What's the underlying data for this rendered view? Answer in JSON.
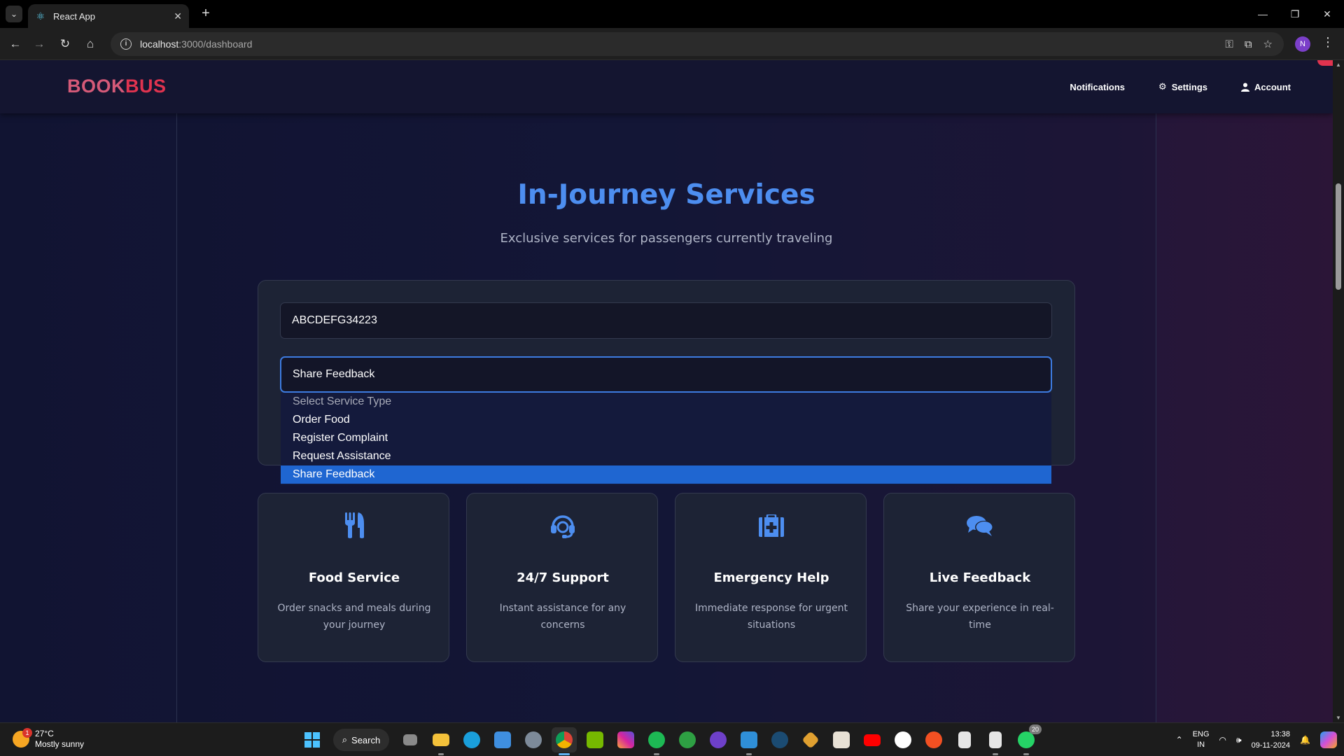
{
  "browser": {
    "tab_title": "React App",
    "url_host": "localhost",
    "url_path": ":3000/dashboard",
    "profile_initial": "N"
  },
  "app": {
    "brand_part1": "BOOK",
    "brand_part2": "BUS",
    "nav": {
      "notifications": "Notifications",
      "settings": "Settings",
      "account": "Account"
    }
  },
  "main": {
    "title": "In-Journey Services",
    "subtitle": "Exclusive services for passengers currently traveling",
    "form": {
      "booking_code_value": "ABCDEFG34223",
      "service_select_value": "Share Feedback",
      "options": [
        {
          "label": "Select Service Type",
          "placeholder": true
        },
        {
          "label": "Order Food"
        },
        {
          "label": "Register Complaint"
        },
        {
          "label": "Request Assistance"
        },
        {
          "label": "Share Feedback",
          "selected": true
        }
      ]
    },
    "cards": [
      {
        "icon": "utensils-icon",
        "title": "Food Service",
        "description": "Order snacks and meals during your journey"
      },
      {
        "icon": "headset-icon",
        "title": "24/7 Support",
        "description": "Instant assistance for any concerns"
      },
      {
        "icon": "first-aid-icon",
        "title": "Emergency Help",
        "description": "Immediate response for urgent situations"
      },
      {
        "icon": "comments-icon",
        "title": "Live Feedback",
        "description": "Share your experience in real-time"
      }
    ],
    "colors": {
      "accent": "#4d8ef0",
      "brand_red": "#e0334f",
      "selected_option": "#1f66d1"
    }
  },
  "taskbar": {
    "weather_temp": "27°C",
    "weather_desc": "Mostly sunny",
    "weather_badge": "1",
    "search_label": "Search",
    "whatsapp_badge": "20",
    "lang_line1": "ENG",
    "lang_line2": "IN",
    "time": "13:38",
    "date": "09-11-2024"
  }
}
